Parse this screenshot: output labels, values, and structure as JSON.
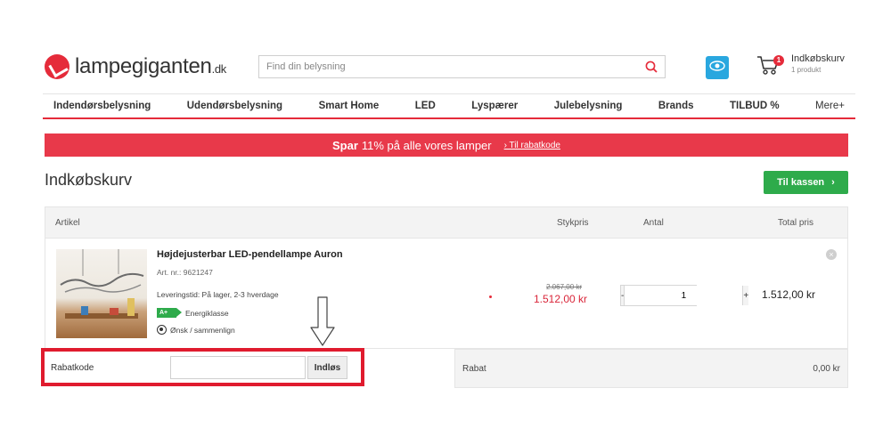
{
  "header": {
    "logo_name": "lampegiganten",
    "logo_tld": ".dk",
    "search_placeholder": "Find din belysning",
    "cart_title": "Indkøbskurv",
    "cart_subtitle": "1 produkt",
    "cart_count": "1",
    "icons": {
      "search": "search-icon",
      "eye": "eye-icon",
      "cart": "cart-icon"
    },
    "colors": {
      "brand": "#e52b3a",
      "eye_button": "#29a7df"
    }
  },
  "nav": {
    "items": [
      "Indendørsbelysning",
      "Udendørsbelysning",
      "Smart Home",
      "LED",
      "Lyspærer",
      "Julebelysning",
      "Brands",
      "TILBUD %",
      "Mere+"
    ]
  },
  "promo": {
    "strong": "Spar",
    "text": "11% på alle vores lamper",
    "link": "› Til rabatkode"
  },
  "page": {
    "title": "Indkøbskurv",
    "checkout_label": "Til kassen",
    "checkout_color": "#2eab4b"
  },
  "table": {
    "headers": {
      "article": "Artikel",
      "unit_price": "Stykpris",
      "quantity": "Antal",
      "total": "Total pris"
    }
  },
  "item": {
    "name": "Højdejusterbar LED-pendellampe Auron",
    "article_no": "Art. nr.: 9621247",
    "delivery": "Leveringstid: På lager, 2-3 hverdage",
    "energy_badge": "A+",
    "energy_label": "Energiklasse",
    "wishlist_label": "Ønsk / sammenlign",
    "old_price": "2.067,00 kr",
    "price": "1.512,00 kr",
    "quantity": "1",
    "minus": "-",
    "plus": "+",
    "total": "1.512,00 kr",
    "remove": "×"
  },
  "coupon": {
    "label": "Rabatkode",
    "input_value": "",
    "button": "Indløs"
  },
  "discount": {
    "label": "Rabat",
    "value": "0,00 kr"
  },
  "annotation": {
    "box_color": "#e01b2e"
  }
}
